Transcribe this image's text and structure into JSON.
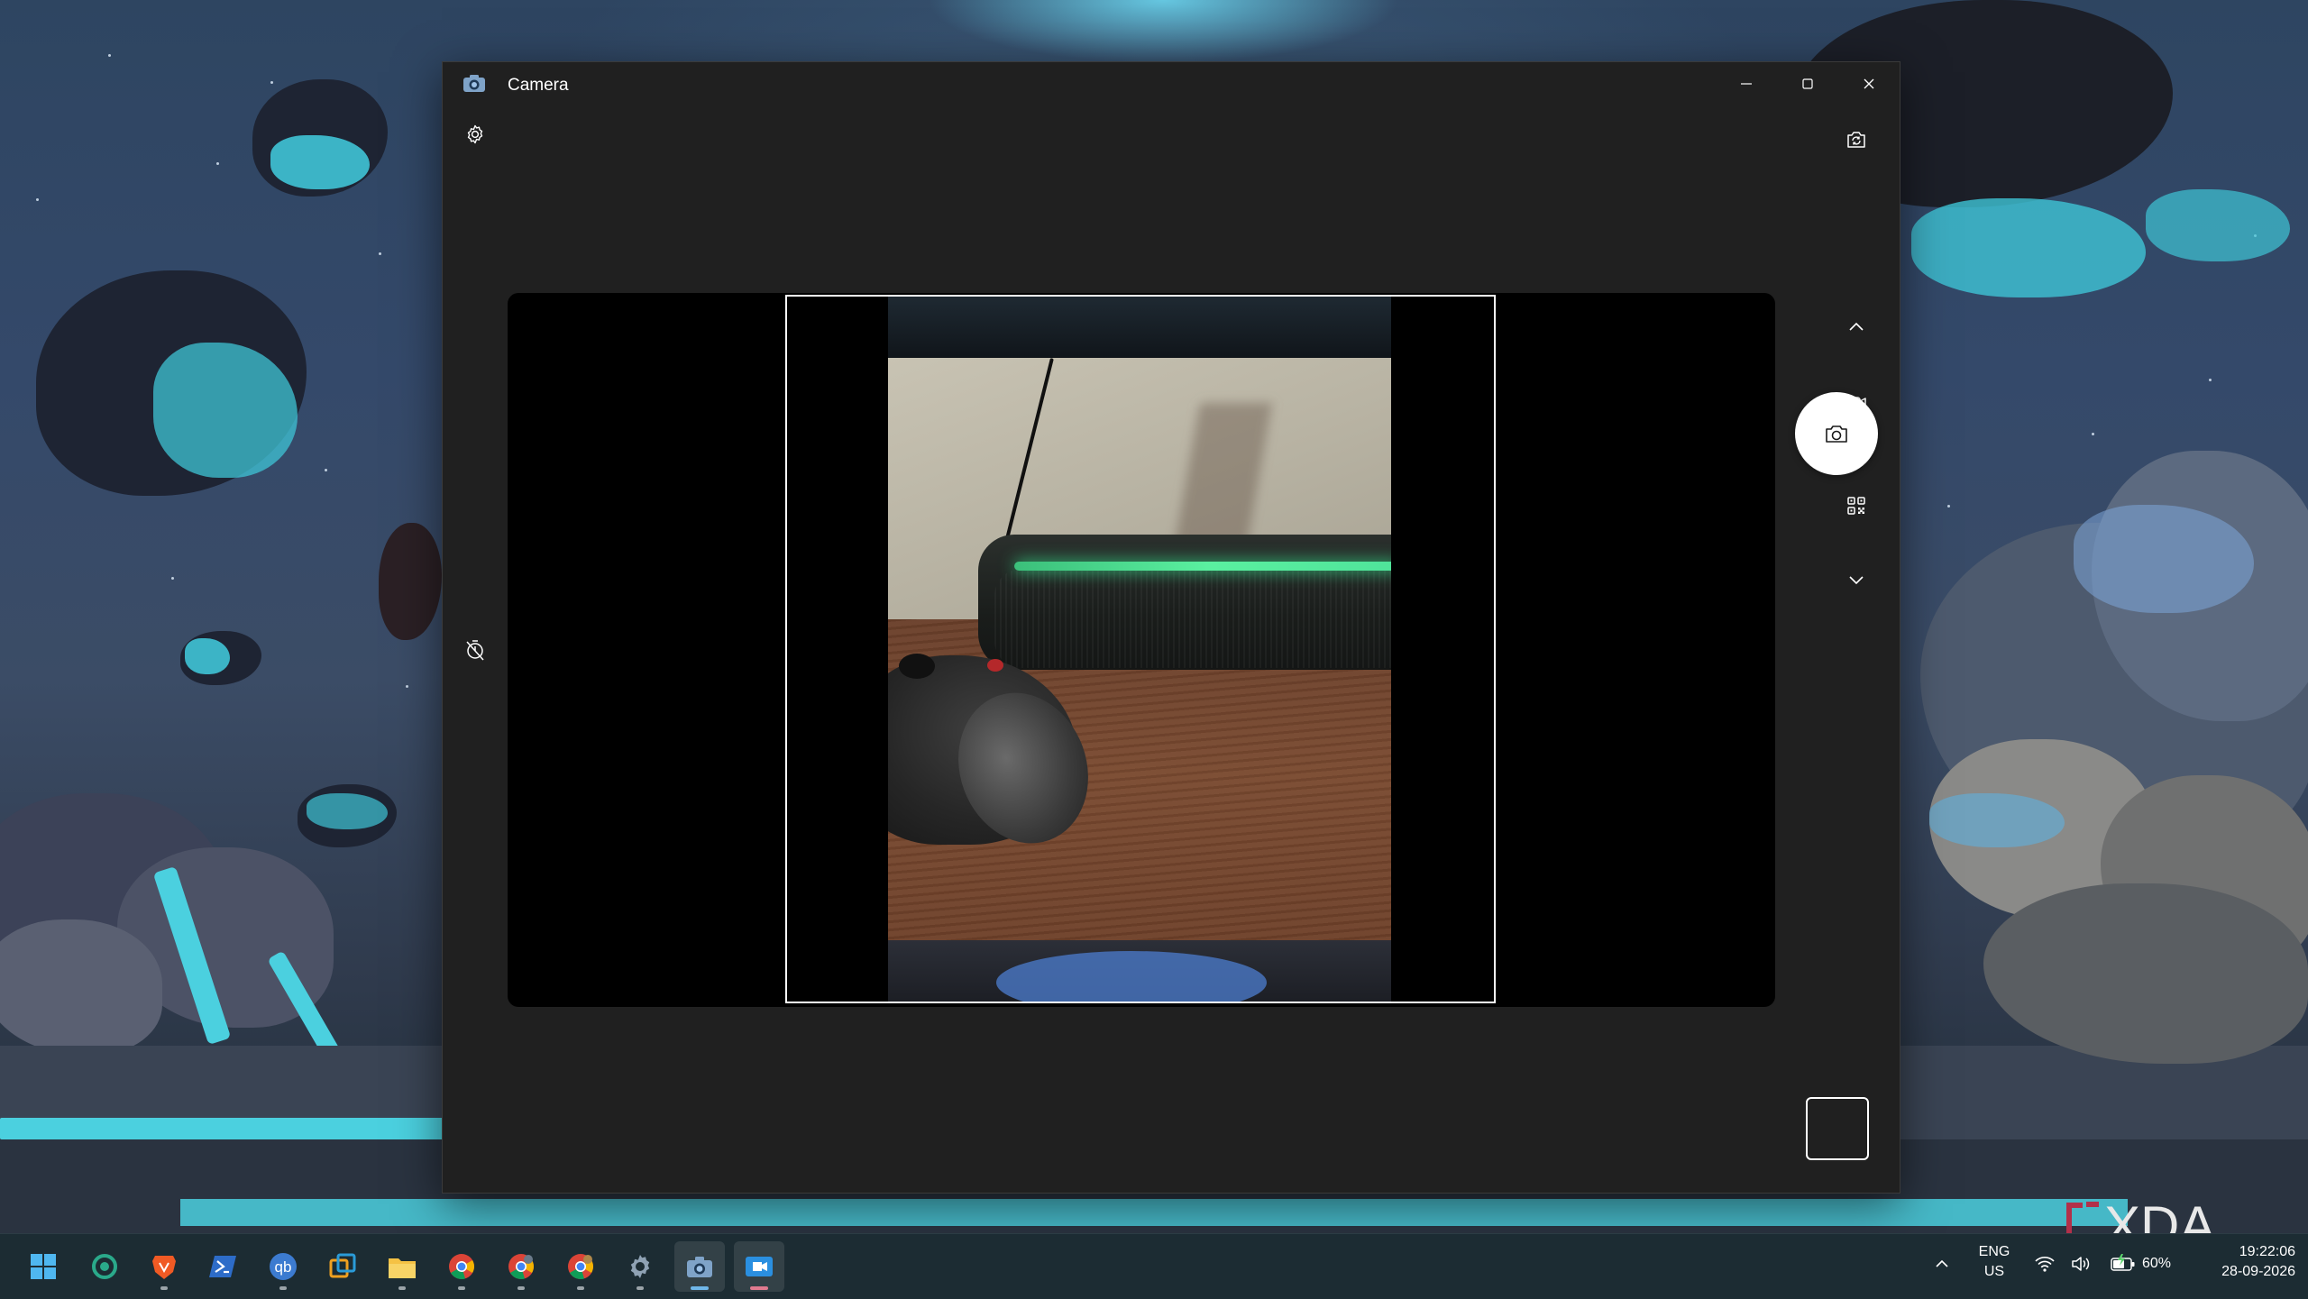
{
  "window": {
    "title": "Camera",
    "controls": {
      "minimize": "minimize-icon",
      "maximize": "maximize-icon",
      "close": "close-icon"
    }
  },
  "toolbar": {
    "settings_icon": "gear-icon",
    "switch_camera_icon": "camera-switch-icon",
    "timer_icon": "timer-off-icon"
  },
  "capture_modes": {
    "scroll_up_icon": "chevron-up-icon",
    "video_icon": "video-camera-icon",
    "photo_icon": "camera-icon",
    "qr_icon": "qr-code-icon",
    "scroll_down_icon": "chevron-down-icon",
    "selected": "photo"
  },
  "taskbar": {
    "apps": [
      {
        "name": "start",
        "icon": "windows-logo-icon"
      },
      {
        "name": "app-launcher",
        "icon": "ring-app-icon"
      },
      {
        "name": "brave",
        "icon": "brave-browser-icon"
      },
      {
        "name": "terminal",
        "icon": "powershell-icon"
      },
      {
        "name": "qbittorrent",
        "icon": "qbittorrent-icon",
        "label": "qb"
      },
      {
        "name": "task-view",
        "icon": "windows-squares-icon"
      },
      {
        "name": "file-explorer",
        "icon": "folder-icon"
      },
      {
        "name": "chrome",
        "icon": "chrome-icon"
      },
      {
        "name": "chrome-profile-2",
        "icon": "chrome-icon"
      },
      {
        "name": "chrome-profile-3",
        "icon": "chrome-icon"
      },
      {
        "name": "settings",
        "icon": "gear-icon"
      },
      {
        "name": "camera",
        "icon": "camera-icon",
        "active": true
      },
      {
        "name": "zoom",
        "icon": "video-app-icon"
      }
    ]
  },
  "tray": {
    "overflow_icon": "chevron-up-icon",
    "language_line1": "ENG",
    "language_line2": "US",
    "wifi_icon": "wifi-icon",
    "volume_icon": "speaker-icon",
    "battery_icon": "battery-charging-icon",
    "battery_percent": "60%",
    "time": "19:22:06",
    "date": "28-09-2026"
  },
  "watermark": {
    "text": "XDA"
  },
  "colors": {
    "window_bg": "#202020",
    "viewfinder_bg": "#000000",
    "shutter": "#ffffff",
    "taskbar_bg": "#1c2c33",
    "accent_splash": "#3fc4d6"
  }
}
